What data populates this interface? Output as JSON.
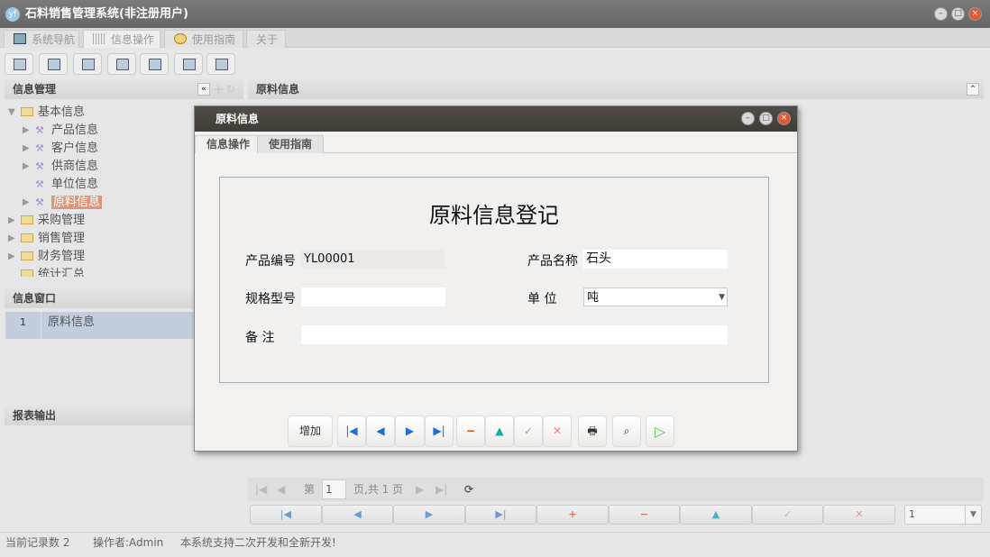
{
  "window": {
    "title": "石料销售管理系统(非注册用户)",
    "logo": "yf"
  },
  "tabs": [
    {
      "label": "系统导航"
    },
    {
      "label": "信息操作"
    },
    {
      "label": "使用指南"
    },
    {
      "label": "关于"
    }
  ],
  "left": {
    "panel_title": "信息管理",
    "tree": [
      {
        "label": "基本信息"
      },
      {
        "label": "产品信息"
      },
      {
        "label": "客户信息"
      },
      {
        "label": "供商信息"
      },
      {
        "label": "单位信息"
      },
      {
        "label": "原料信息"
      },
      {
        "label": "采购管理"
      },
      {
        "label": "销售管理"
      },
      {
        "label": "财务管理"
      },
      {
        "label": "统计汇总"
      }
    ],
    "window_title": "信息窗口",
    "window_rows": [
      {
        "index": "1",
        "label": "原料信息"
      }
    ],
    "report_title": "报表输出"
  },
  "right": {
    "panel_title": "原料信息",
    "pager": {
      "prefix": "第",
      "page": "1",
      "suffix": "页,共 1 页"
    },
    "page_size": "1"
  },
  "modal": {
    "title": "原料信息",
    "tabs": [
      "信息操作",
      "使用指南"
    ],
    "form_title": "原料信息登记",
    "fields": {
      "code_label": "产品编号",
      "code_value": "YL00001",
      "name_label": "产品名称",
      "name_value": "石头",
      "spec_label": "规格型号",
      "spec_value": "",
      "unit_label": "单 位",
      "unit_value": "吨",
      "note_label": "备 注",
      "note_value": ""
    },
    "add_label": "增加"
  },
  "status": {
    "records": "当前记录数 2",
    "operator": "操作者:Admin",
    "message": "本系统支持二次开发和全新开发!"
  }
}
